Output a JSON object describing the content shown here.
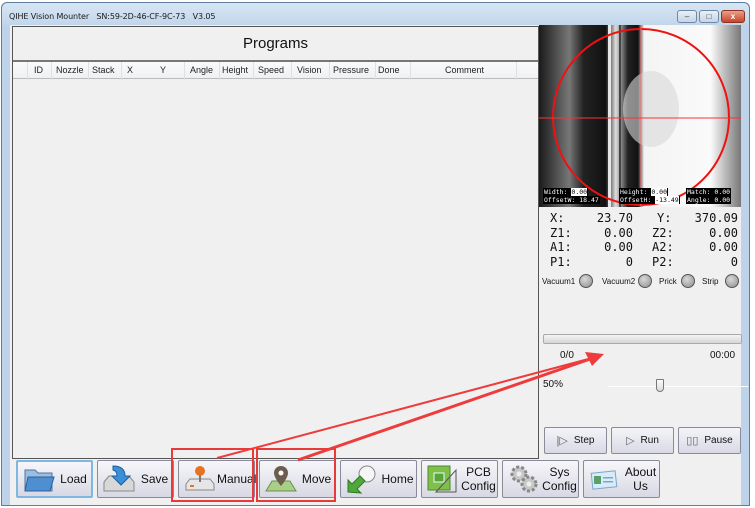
{
  "window": {
    "title": "QIHE Vision Mounter",
    "serial": "SN:59-2D-46-CF-9C-73",
    "version": "V3.05",
    "controls": {
      "minimize": "–",
      "maximize": "□",
      "close": "x"
    }
  },
  "programs": {
    "title": "Programs",
    "columns": [
      "ID",
      "Nozzle",
      "Stack",
      "X",
      "Y",
      "Angle",
      "Height",
      "Speed",
      "Vision",
      "Pressure",
      "Done",
      "Comment"
    ],
    "rows": []
  },
  "camera": {
    "width_label": "Width:",
    "width_value": "0.00",
    "height_label": "Height:",
    "height_value": "0.00",
    "match_label": "Match:",
    "match_value": "0.00",
    "offsetw_label": "OffsetW:",
    "offsetw_value": "18.47",
    "offseth_label": "OffsetH:",
    "offseth_value": "-13.49",
    "angle_label": "Angle:",
    "angle_value": "0.00"
  },
  "coordinates": {
    "x_label": "X:",
    "x_value": "23.70",
    "y_label": "Y:",
    "y_value": "370.09",
    "z1_label": "Z1:",
    "z1_value": "0.00",
    "z2_label": "Z2:",
    "z2_value": "0.00",
    "a1_label": "A1:",
    "a1_value": "0.00",
    "a2_label": "A2:",
    "a2_value": "0.00",
    "p1_label": "P1:",
    "p1_value": "0",
    "p2_label": "P2:",
    "p2_value": "0"
  },
  "indicators": [
    {
      "label": "Vacuum1",
      "state": "off"
    },
    {
      "label": "Vacuum2",
      "state": "off"
    },
    {
      "label": "Prick",
      "state": "off"
    },
    {
      "label": "Strip",
      "state": "off"
    }
  ],
  "progress": {
    "count": "0/0",
    "time": "00:00",
    "fraction": 0
  },
  "speed": {
    "label": "50%",
    "value_percent": 50
  },
  "run_controls": {
    "step": "Step",
    "run": "Run",
    "pause": "Pause"
  },
  "toolbar": {
    "load": "Load",
    "save": "Save",
    "manual": "Manual",
    "move": "Move",
    "home": "Home",
    "pcb_config_1": "PCB",
    "pcb_config_2": "Config",
    "sys_config_1": "Sys",
    "sys_config_2": "Config",
    "about_1": "About",
    "about_2": "Us"
  },
  "annotation": {
    "color": "#e83a3a",
    "highlighted": [
      "Manual",
      "Move"
    ]
  }
}
